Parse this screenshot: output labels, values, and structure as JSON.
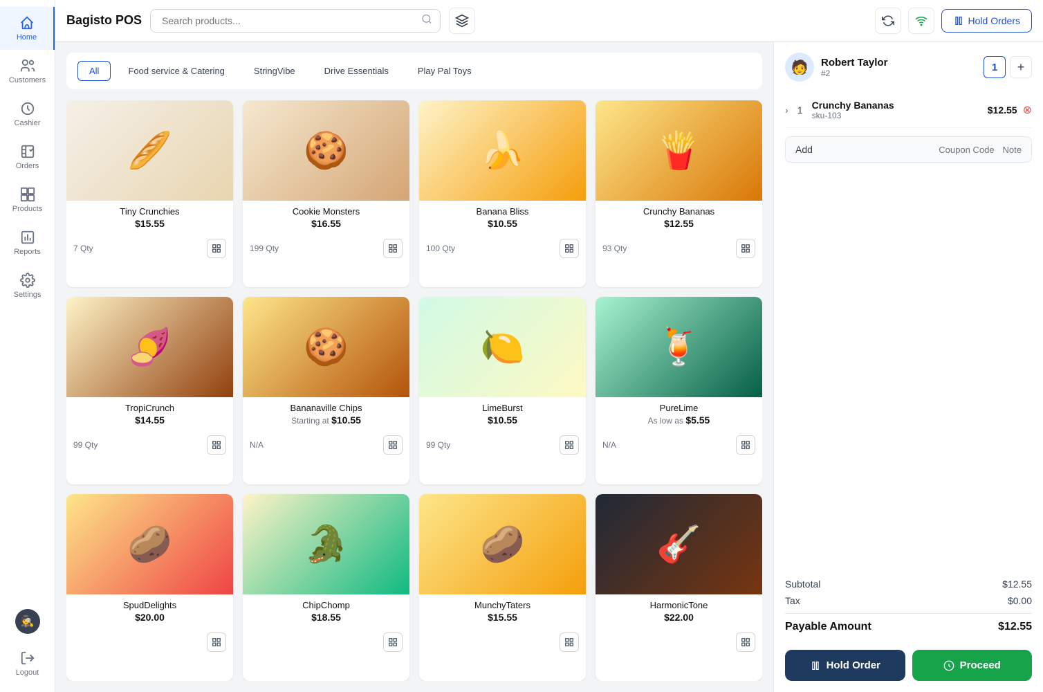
{
  "app": {
    "title": "Bagisto POS"
  },
  "topbar": {
    "search_placeholder": "Search products...",
    "hold_orders_label": "Hold Orders"
  },
  "sidebar": {
    "items": [
      {
        "id": "home",
        "label": "Home",
        "active": true
      },
      {
        "id": "customers",
        "label": "Customers",
        "active": false
      },
      {
        "id": "cashier",
        "label": "Cashier",
        "active": false
      },
      {
        "id": "orders",
        "label": "Orders",
        "active": false
      },
      {
        "id": "products",
        "label": "Products",
        "active": false
      },
      {
        "id": "reports",
        "label": "Reports",
        "active": false
      },
      {
        "id": "settings",
        "label": "Settings",
        "active": false
      }
    ]
  },
  "categories": [
    {
      "id": "all",
      "label": "All",
      "active": true
    },
    {
      "id": "food",
      "label": "Food service & Catering",
      "active": false
    },
    {
      "id": "stringvibe",
      "label": "StringVibe",
      "active": false
    },
    {
      "id": "drive",
      "label": "Drive Essentials",
      "active": false
    },
    {
      "id": "playpal",
      "label": "Play Pal Toys",
      "active": false
    }
  ],
  "products": [
    {
      "id": 1,
      "name": "Tiny Crunchies",
      "price": "$15.55",
      "qty": "7 Qty",
      "emoji": "🥖",
      "img_class": "img-tiny-crunchies"
    },
    {
      "id": 2,
      "name": "Cookie Monsters",
      "price": "$16.55",
      "qty": "199 Qty",
      "emoji": "🍪",
      "img_class": "img-cookie-monsters"
    },
    {
      "id": 3,
      "name": "Banana Bliss",
      "price": "$10.55",
      "qty": "100 Qty",
      "emoji": "🍌",
      "img_class": "img-banana-bliss"
    },
    {
      "id": 4,
      "name": "Crunchy Bananas",
      "price": "$12.55",
      "qty": "93 Qty",
      "emoji": "🍟",
      "img_class": "img-crunchy-bananas"
    },
    {
      "id": 5,
      "name": "TropiCrunch",
      "price": "$14.55",
      "qty": "99 Qty",
      "emoji": "🍠",
      "img_class": "img-tropicrouch"
    },
    {
      "id": 6,
      "name": "Bananaville Chips",
      "price": "$10.55",
      "price_prefix": "Starting at",
      "qty": "N/A",
      "emoji": "🍪",
      "img_class": "img-bananaville"
    },
    {
      "id": 7,
      "name": "LimeBurst",
      "price": "$10.55",
      "qty": "99 Qty",
      "emoji": "🍋",
      "img_class": "img-limeburst"
    },
    {
      "id": 8,
      "name": "PureLime",
      "price": "$5.55",
      "price_prefix": "As low as",
      "qty": "N/A",
      "emoji": "🍹",
      "img_class": "img-purelime"
    },
    {
      "id": 9,
      "name": "SpudDelights",
      "price": "$20.00",
      "qty": "",
      "emoji": "🥔",
      "img_class": "img-spuddelights"
    },
    {
      "id": 10,
      "name": "ChipChomp",
      "price": "$18.55",
      "qty": "",
      "emoji": "🐊",
      "img_class": "img-chipchomp"
    },
    {
      "id": 11,
      "name": "MunchyTaters",
      "price": "$15.55",
      "qty": "",
      "emoji": "🥔",
      "img_class": "img-munchytaters"
    },
    {
      "id": 12,
      "name": "HarmonicTone",
      "price": "$22.00",
      "qty": "",
      "emoji": "🎸",
      "img_class": "img-harmonictone"
    }
  ],
  "cart": {
    "customer": {
      "name": "Robert Taylor",
      "number": "#2",
      "avatar_emoji": "🧑"
    },
    "qty_display": "1",
    "items": [
      {
        "qty": 1,
        "name": "Crunchy Bananas",
        "sku": "sku-103",
        "price": "$12.55"
      }
    ],
    "add_label": "Add",
    "coupon_label": "Coupon Code",
    "note_label": "Note",
    "subtotal_label": "Subtotal",
    "subtotal_value": "$12.55",
    "tax_label": "Tax",
    "tax_value": "$0.00",
    "payable_label": "Payable Amount",
    "payable_value": "$12.55",
    "hold_order_label": "Hold Order",
    "proceed_label": "Proceed"
  }
}
